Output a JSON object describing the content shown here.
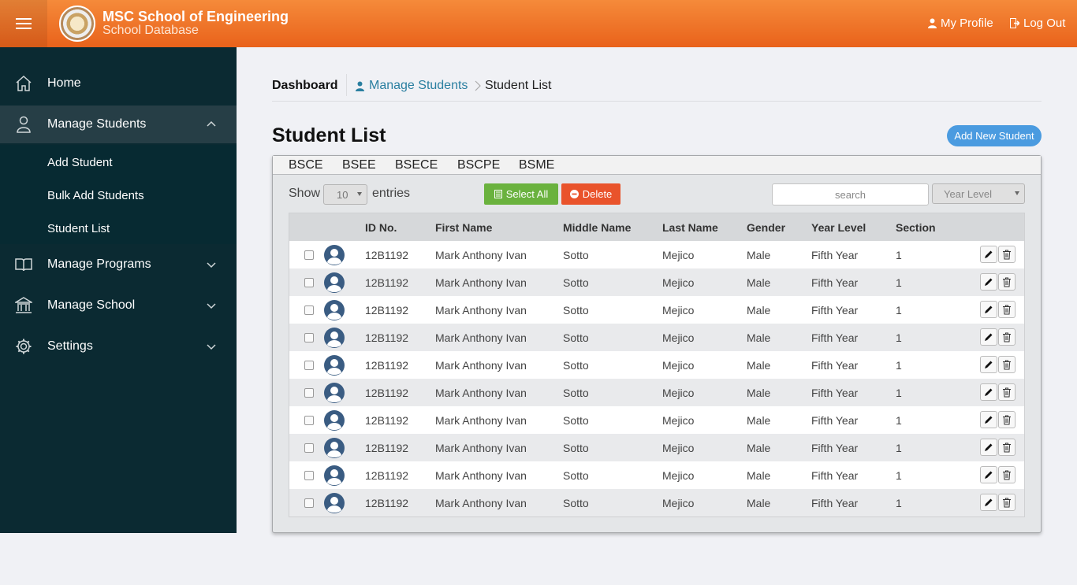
{
  "header": {
    "title": "MSC School of Engineering",
    "subtitle": "School Database",
    "profile_label": "My Profile",
    "logout_label": "Log Out"
  },
  "sidebar": {
    "home": "Home",
    "manage_students": "Manage Students",
    "sub_items": [
      "Add Student",
      "Bulk Add Students",
      "Student List"
    ],
    "manage_programs": "Manage Programs",
    "manage_school": "Manage School",
    "settings": "Settings"
  },
  "breadcrumb": {
    "dashboard": "Dashboard",
    "manage_students": "Manage Students",
    "student_list": "Student List"
  },
  "page": {
    "title": "Student List",
    "add_button": "Add New Student"
  },
  "program_tabs": [
    "BSCE",
    "BSEE",
    "BSECE",
    "BSCPE",
    "BSME"
  ],
  "controls": {
    "show_label": "Show",
    "entries_value": "10",
    "entries_label": "entries",
    "select_all": "Select All",
    "delete": "Delete",
    "search_placeholder": "search",
    "year_level_placeholder": "Year Level"
  },
  "table": {
    "columns": [
      "ID No.",
      "First Name",
      "Middle Name",
      "Last Name",
      "Gender",
      "Year Level",
      "Section"
    ],
    "rows": [
      {
        "id": "12B1192",
        "first": "Mark Anthony Ivan",
        "middle": "Sotto",
        "last": "Mejico",
        "gender": "Male",
        "year": "Fifth Year",
        "section": "1"
      },
      {
        "id": "12B1192",
        "first": "Mark Anthony Ivan",
        "middle": "Sotto",
        "last": "Mejico",
        "gender": "Male",
        "year": "Fifth Year",
        "section": "1"
      },
      {
        "id": "12B1192",
        "first": "Mark Anthony Ivan",
        "middle": "Sotto",
        "last": "Mejico",
        "gender": "Male",
        "year": "Fifth Year",
        "section": "1"
      },
      {
        "id": "12B1192",
        "first": "Mark Anthony Ivan",
        "middle": "Sotto",
        "last": "Mejico",
        "gender": "Male",
        "year": "Fifth Year",
        "section": "1"
      },
      {
        "id": "12B1192",
        "first": "Mark Anthony Ivan",
        "middle": "Sotto",
        "last": "Mejico",
        "gender": "Male",
        "year": "Fifth Year",
        "section": "1"
      },
      {
        "id": "12B1192",
        "first": "Mark Anthony Ivan",
        "middle": "Sotto",
        "last": "Mejico",
        "gender": "Male",
        "year": "Fifth Year",
        "section": "1"
      },
      {
        "id": "12B1192",
        "first": "Mark Anthony Ivan",
        "middle": "Sotto",
        "last": "Mejico",
        "gender": "Male",
        "year": "Fifth Year",
        "section": "1"
      },
      {
        "id": "12B1192",
        "first": "Mark Anthony Ivan",
        "middle": "Sotto",
        "last": "Mejico",
        "gender": "Male",
        "year": "Fifth Year",
        "section": "1"
      },
      {
        "id": "12B1192",
        "first": "Mark Anthony Ivan",
        "middle": "Sotto",
        "last": "Mejico",
        "gender": "Male",
        "year": "Fifth Year",
        "section": "1"
      },
      {
        "id": "12B1192",
        "first": "Mark Anthony Ivan",
        "middle": "Sotto",
        "last": "Mejico",
        "gender": "Male",
        "year": "Fifth Year",
        "section": "1"
      }
    ]
  },
  "icons": {
    "menu": "hamburger-icon",
    "profile": "user-icon",
    "logout": "logout-icon",
    "home": "home-icon",
    "students": "person-icon",
    "programs": "book-icon",
    "school": "bank-icon",
    "settings": "gear-icon",
    "edit": "pencil-icon",
    "delete": "trash-icon"
  },
  "colors": {
    "header": "#ef7428",
    "sidebar": "#0b2a32",
    "accent_blue": "#4a9be0",
    "select_all_green": "#6ab23e",
    "delete_red": "#e9532b"
  }
}
